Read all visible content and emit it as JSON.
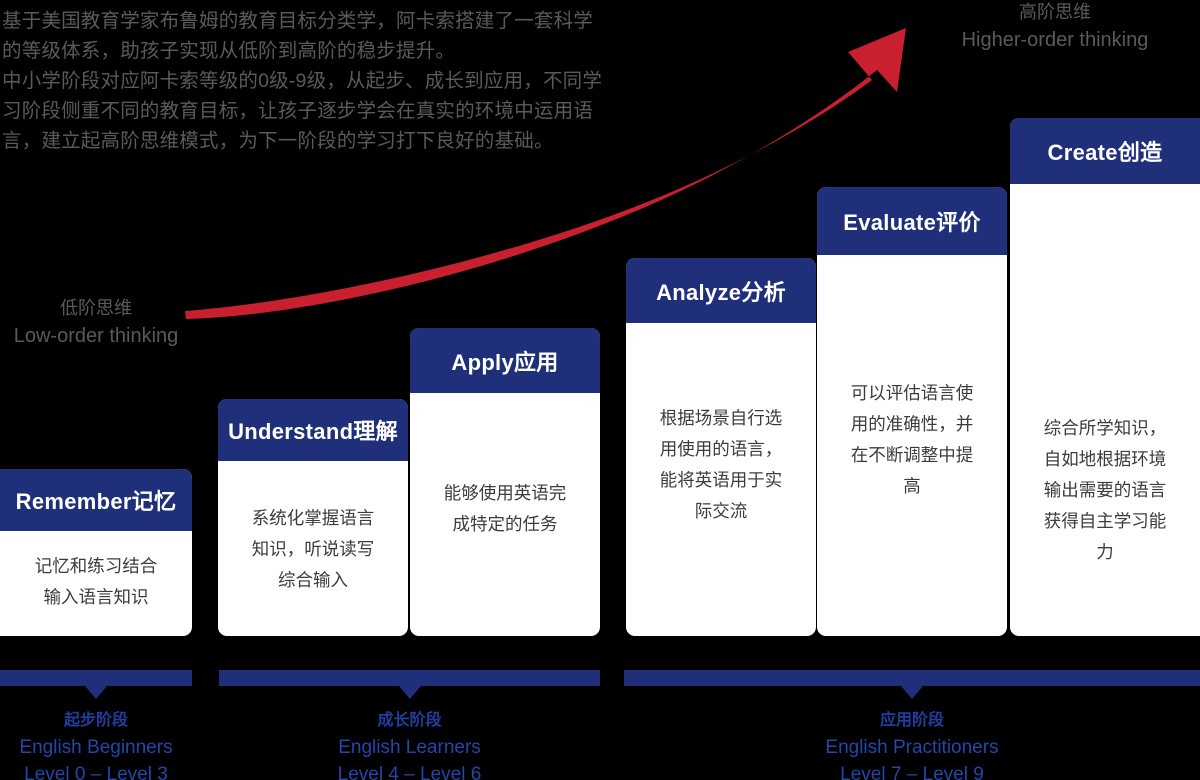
{
  "intro": {
    "text": "基于美国教育学家布鲁姆的教育目标分类学，阿卡索搭建了一套科学\n的等级体系，助孩子实现从低阶到高阶的稳步提升。\n中小学阶段对应阿卡索等级的0级-9级，从起步、成长到应用，不同学\n习阶段侧重不同的教育目标，让孩子逐步学会在真实的环境中运用语\n言，建立起高阶思维模式，为下一阶段的学习打下良好的基础。"
  },
  "thinking": {
    "low": {
      "cn": "低阶思维",
      "en": "Low-order thinking"
    },
    "high": {
      "cn": "高阶思维",
      "en": "Higher-order thinking"
    }
  },
  "colors": {
    "background": "#000000",
    "card_header": "#1f2f7a",
    "card_body": "#ffffff",
    "arrow": "#c8202e",
    "intro_text": "#5a5a5a",
    "stage_text": "#2346a8"
  },
  "cards": [
    {
      "key": "remember",
      "title": "Remember记忆",
      "body": "记忆和练习结合\n输入语言知识"
    },
    {
      "key": "understand",
      "title": "Understand理解",
      "body": "系统化掌握语言\n知识，听说读写\n综合输入"
    },
    {
      "key": "apply",
      "title": "Apply应用",
      "body": "能够使用英语完\n成特定的任务"
    },
    {
      "key": "analyze",
      "title": "Analyze分析",
      "body": "根据场景自行选\n用使用的语言，\n能将英语用于实\n际交流"
    },
    {
      "key": "evaluate",
      "title": "Evaluate评价",
      "body": "可以评估语言使\n用的准确性，并\n在不断调整中提\n高"
    },
    {
      "key": "create",
      "title": "Create创造",
      "body": "综合所学知识，\n自如地根据环境\n输出需要的语言\n获得自主学习能\n力"
    }
  ],
  "stages": [
    {
      "key": "beginners",
      "cn": "起步阶段",
      "en": "English Beginners",
      "levels": "Level 0 – Level 3"
    },
    {
      "key": "learners",
      "cn": "成长阶段",
      "en": "English Learners",
      "levels": "Level 4 – Level 6"
    },
    {
      "key": "practitioners",
      "cn": "应用阶段",
      "en": "English Practitioners",
      "levels": "Level 7 – Level 9"
    }
  ]
}
